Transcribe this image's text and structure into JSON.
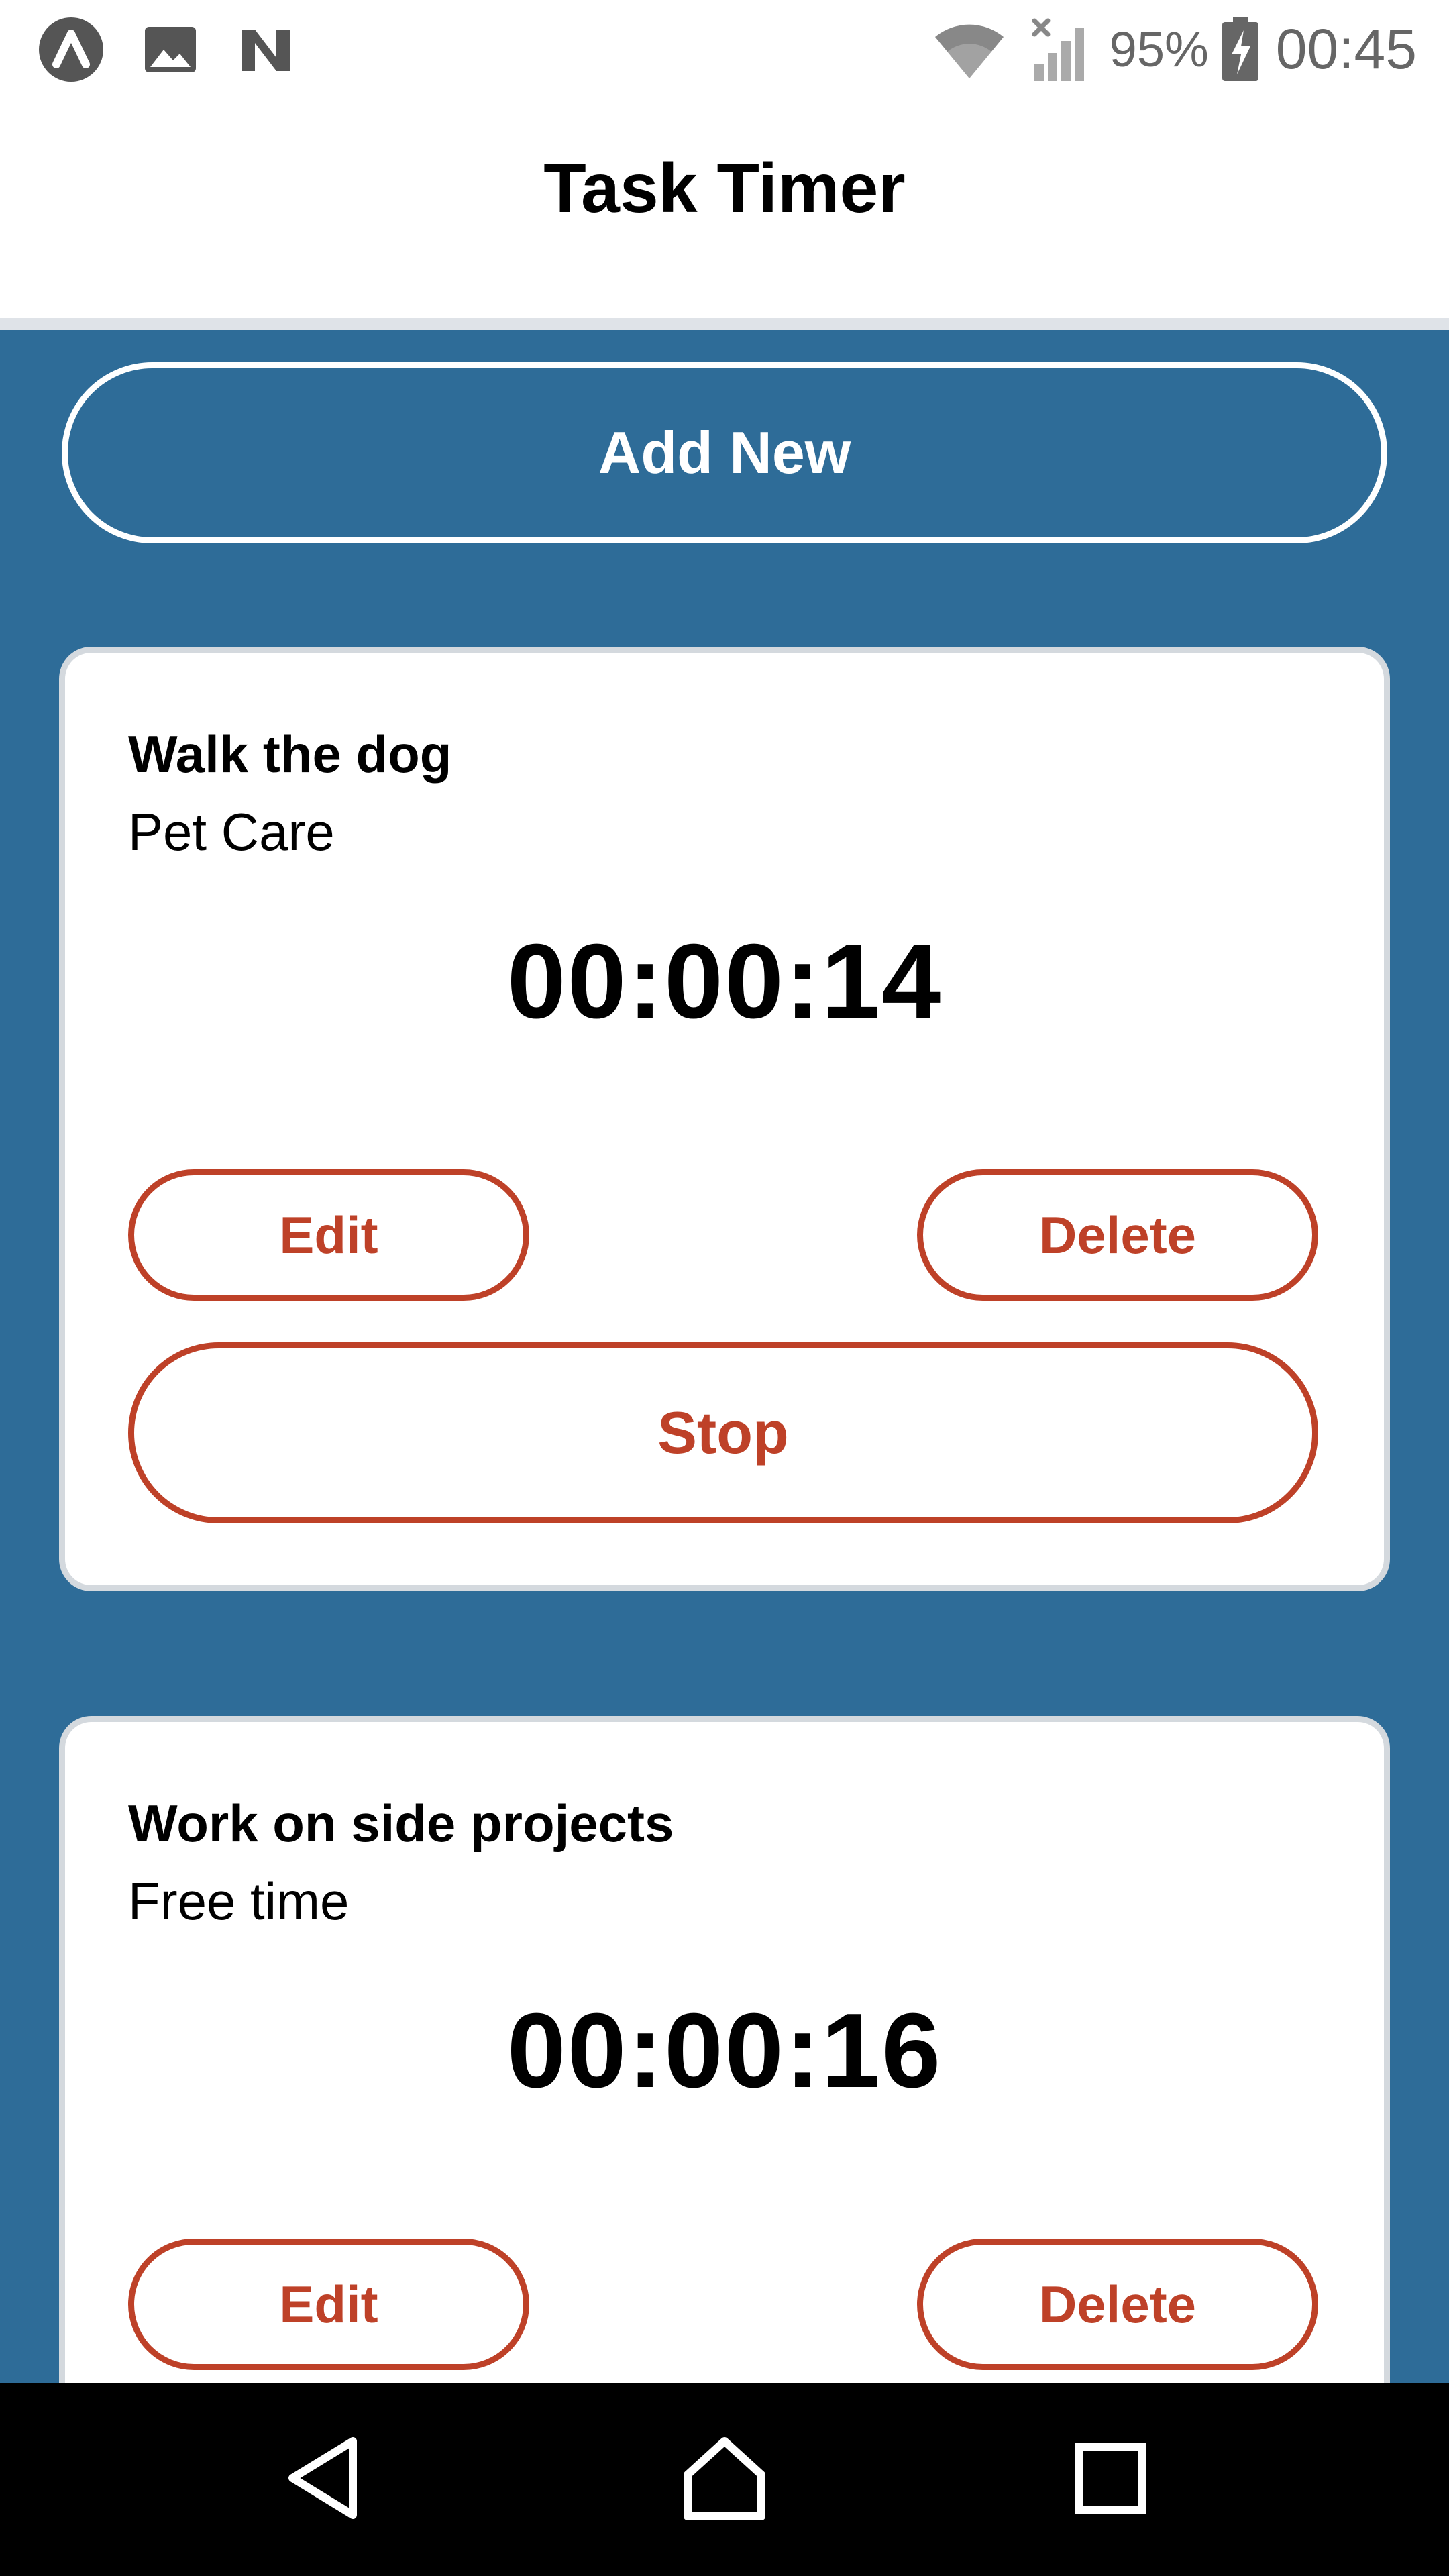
{
  "status_bar": {
    "left_icons": [
      "app-logo-icon",
      "image-icon",
      "nfc-icon"
    ],
    "right_icons": [
      "wifi-icon",
      "signal-no-data-icon",
      "battery-charging-icon"
    ],
    "battery_percent": "95%",
    "time": "00:45"
  },
  "header": {
    "title": "Task Timer"
  },
  "actions": {
    "add_new_label": "Add New"
  },
  "tasks": [
    {
      "name": "Walk the dog",
      "category": "Pet Care",
      "elapsed": "00:00:14",
      "edit_label": "Edit",
      "delete_label": "Delete",
      "toggle_label": "Stop"
    },
    {
      "name": "Work on side projects",
      "category": "Free time",
      "elapsed": "00:00:16",
      "edit_label": "Edit",
      "delete_label": "Delete"
    }
  ],
  "nav_bar": {
    "buttons": [
      "back-icon",
      "home-icon",
      "recents-icon"
    ]
  },
  "colors": {
    "content_background": "#2e6c98",
    "accent": "#be4128",
    "card_border": "#d4d9de",
    "status_text": "#666666"
  }
}
